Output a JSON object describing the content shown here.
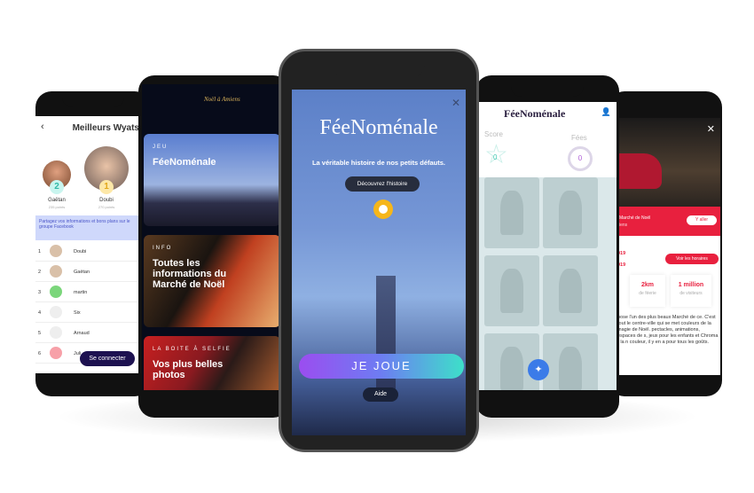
{
  "leaderboard": {
    "title": "Meilleurs Wyats",
    "podium": [
      {
        "rank": "2",
        "name": "Gaëtan",
        "points": "235 points"
      },
      {
        "rank": "1",
        "name": "Doubi",
        "points": "270 points"
      }
    ],
    "facebook_banner": "Partagez vos informations et bons plans sur le groupe Facebook",
    "rows": [
      {
        "rank": "1",
        "name": "Doubi"
      },
      {
        "rank": "2",
        "name": "Gaëtan"
      },
      {
        "rank": "3",
        "name": "martin"
      },
      {
        "rank": "4",
        "name": "Six"
      },
      {
        "rank": "5",
        "name": "Arnaud"
      },
      {
        "rank": "6",
        "name": "Juli"
      }
    ],
    "connect_button": "Se connecter"
  },
  "home": {
    "logo": "Noël à Amiens",
    "cards": [
      {
        "kicker": "JEU",
        "title": "FéeNoménale"
      },
      {
        "kicker": "INFO",
        "title": "Toutes les informations du Marché de Noël"
      },
      {
        "kicker": "LA BOITE À SELFIE",
        "title": "Vos plus belles photos"
      }
    ]
  },
  "game_intro": {
    "title": "FéeNoménale",
    "subtitle": "La véritable histoire de nos petits défauts.",
    "discover_button": "Découvrez l'histoire",
    "play_button": "JE JOUE",
    "help_button": "Aide"
  },
  "game": {
    "logo": "FéeNoménale",
    "score_label": "Score",
    "score": "0",
    "fairies_label": "Fées",
    "fairies": "0"
  },
  "market": {
    "banner_title": "Marché de Noël",
    "banner_sub": "iens",
    "go_button": "Y aller",
    "date1": "019",
    "date2": "019",
    "hours_button": "Voir les horaires",
    "stats": [
      {
        "value": "2km",
        "label": "de féerie"
      },
      {
        "value": "1 million",
        "label": "de visiteurs"
      }
    ],
    "description": "pose l'un des plus beaux Marché de ce. C'est tout le centre-ville qui se met couleurs de la magie de Noël. pectacles, animations, espaces de s, jeux pour les enfants et Chroma - la n couleur, il y en a pour tous les goûts."
  },
  "colors": {
    "accent_red": "#e8203e",
    "play_gradient_start": "#9b4df0",
    "play_gradient_end": "#3de0c9",
    "connect": "#1d1150"
  }
}
